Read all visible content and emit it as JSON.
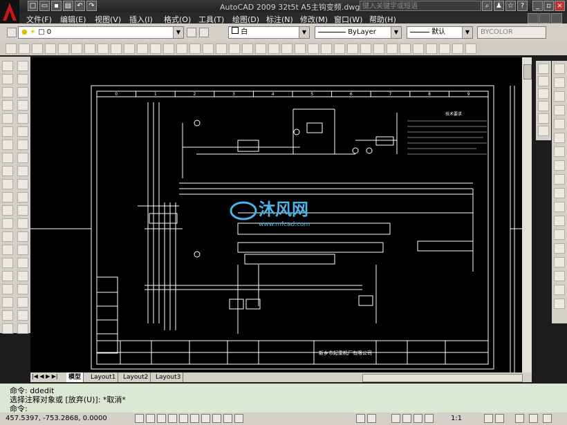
{
  "titlebar": {
    "title": "AutoCAD 2009  32t5t  A5主钩变频.dwg",
    "search_placeholder": "键入关键字或短语"
  },
  "menu": [
    "文件(F)",
    "编辑(E)",
    "视图(V)",
    "插入(I)",
    "格式(O)",
    "工具(T)",
    "绘图(D)",
    "标注(N)",
    "修改(M)",
    "窗口(W)",
    "帮助(H)"
  ],
  "layers": {
    "current_layer": "0",
    "color": "白",
    "linetype": "ByLayer",
    "lineweight": "默认",
    "plotstyle": "BYCOLOR"
  },
  "drawing": {
    "watermark_brand": "沐风网",
    "watermark_url": "www.mfcad.com",
    "notes_title": "技术要求",
    "company": "新乡市起重机厂有限公司",
    "column_numbers": [
      "0",
      "1",
      "2",
      "3",
      "4",
      "5",
      "6",
      "7",
      "8",
      "9"
    ]
  },
  "tabs": [
    "模型",
    "Layout1",
    "Layout2",
    "Layout3"
  ],
  "command": {
    "line1": "命令:  ddedit",
    "line2": "选择注释对象或 [放弃(U)]: *取消*",
    "line3": "命令:"
  },
  "status": {
    "coords": "457.5397, -753.2868, 0.0000",
    "scale": "1:1"
  },
  "colors": {
    "canvas": "#000000",
    "toolbar": "#d4d0c8",
    "command_bg": "#dde8d4",
    "drawing_lines": "#ffffff",
    "watermark": "#4fb3e8"
  }
}
